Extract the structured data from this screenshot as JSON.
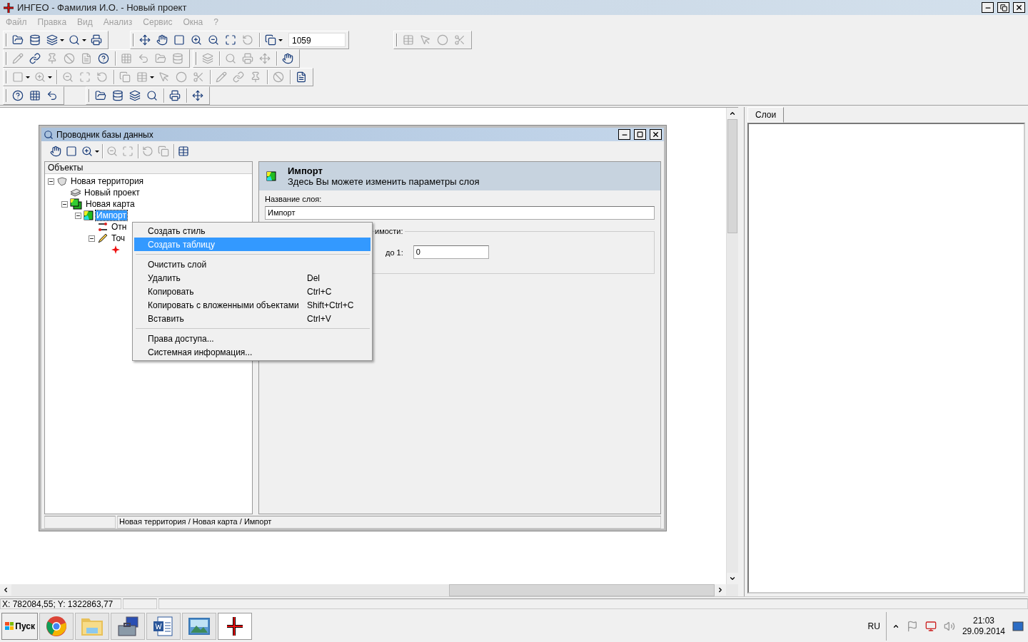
{
  "window": {
    "title": "ИНГЕО - Фамилия И.О. - Новый проект"
  },
  "menu": [
    {
      "label": "Файл",
      "disabled": true
    },
    {
      "label": "Правка",
      "disabled": true
    },
    {
      "label": "Вид",
      "disabled": true
    },
    {
      "label": "Анализ",
      "disabled": true
    },
    {
      "label": "Сервис",
      "disabled": true
    },
    {
      "label": "Окна",
      "disabled": true
    },
    {
      "label": "?",
      "disabled": true
    }
  ],
  "toolbars": [
    {
      "bars": [
        {
          "groups": [
            {
              "buttons": [
                {
                  "kind": "button",
                  "disabled": false
                },
                {
                  "kind": "button",
                  "disabled": false
                },
                {
                  "kind": "dropdown",
                  "disabled": false
                },
                {
                  "kind": "dropdown",
                  "disabled": false
                },
                {
                  "kind": "button",
                  "disabled": false
                }
              ]
            }
          ]
        },
        {
          "groups": [
            {
              "buttons": [
                {
                  "kind": "button",
                  "disabled": false
                },
                {
                  "kind": "button",
                  "disabled": false
                },
                {
                  "kind": "button",
                  "disabled": false
                },
                {
                  "kind": "button",
                  "disabled": false
                },
                {
                  "kind": "button",
                  "disabled": false
                },
                {
                  "kind": "button",
                  "disabled": false
                },
                {
                  "kind": "button",
                  "disabled": true
                }
              ]
            },
            {
              "buttons": [
                {
                  "kind": "dropdown",
                  "disabled": false
                }
              ]
            }
          ],
          "field": "1059"
        },
        {
          "groups": [
            {
              "buttons": [
                {
                  "kind": "button",
                  "disabled": true
                },
                {
                  "kind": "button",
                  "disabled": true
                },
                {
                  "kind": "button",
                  "disabled": true
                },
                {
                  "kind": "button",
                  "disabled": true
                }
              ]
            }
          ]
        }
      ]
    },
    {
      "bars": [
        {
          "groups": [
            {
              "buttons": [
                {
                  "kind": "button",
                  "disabled": true
                },
                {
                  "kind": "button",
                  "disabled": false
                },
                {
                  "kind": "button",
                  "disabled": true
                },
                {
                  "kind": "button",
                  "disabled": true
                },
                {
                  "kind": "button",
                  "disabled": true
                },
                {
                  "kind": "button",
                  "disabled": false
                }
              ]
            },
            {
              "buttons": [
                {
                  "kind": "button",
                  "disabled": true
                },
                {
                  "kind": "button",
                  "disabled": true
                },
                {
                  "kind": "button",
                  "disabled": true
                },
                {
                  "kind": "button",
                  "disabled": true
                }
              ]
            }
          ]
        },
        {
          "groups": [
            {
              "buttons": [
                {
                  "kind": "button",
                  "disabled": true
                }
              ]
            },
            {
              "buttons": [
                {
                  "kind": "button",
                  "disabled": true
                },
                {
                  "kind": "button",
                  "disabled": true
                },
                {
                  "kind": "button",
                  "disabled": true
                }
              ]
            },
            {
              "buttons": [
                {
                  "kind": "button",
                  "disabled": false
                }
              ]
            }
          ]
        }
      ]
    },
    {
      "bars": [
        {
          "groups": [
            {
              "buttons": [
                {
                  "kind": "dropdown",
                  "disabled": true
                },
                {
                  "kind": "dropdown",
                  "disabled": true
                }
              ]
            },
            {
              "buttons": [
                {
                  "kind": "button",
                  "disabled": true
                },
                {
                  "kind": "button",
                  "disabled": true
                },
                {
                  "kind": "button",
                  "disabled": true
                }
              ]
            },
            {
              "buttons": [
                {
                  "kind": "button",
                  "disabled": true
                },
                {
                  "kind": "dropdown",
                  "disabled": true
                },
                {
                  "kind": "button",
                  "disabled": true
                },
                {
                  "kind": "button",
                  "disabled": true
                },
                {
                  "kind": "button",
                  "disabled": true
                }
              ]
            },
            {
              "buttons": [
                {
                  "kind": "button",
                  "disabled": true
                },
                {
                  "kind": "button",
                  "disabled": true
                },
                {
                  "kind": "button",
                  "disabled": true
                }
              ]
            },
            {
              "buttons": [
                {
                  "kind": "button",
                  "disabled": true
                }
              ]
            },
            {
              "buttons": [
                {
                  "kind": "button",
                  "disabled": false
                }
              ]
            }
          ]
        }
      ]
    },
    {
      "bars": [
        {
          "groups": [
            {
              "buttons": [
                {
                  "kind": "button",
                  "disabled": false
                },
                {
                  "kind": "button",
                  "disabled": false
                },
                {
                  "kind": "button",
                  "disabled": false
                }
              ]
            }
          ]
        },
        {
          "groups": [
            {
              "buttons": [
                {
                  "kind": "button",
                  "disabled": false
                },
                {
                  "kind": "button",
                  "disabled": false
                },
                {
                  "kind": "button",
                  "disabled": false
                },
                {
                  "kind": "button",
                  "disabled": false
                }
              ]
            },
            {
              "buttons": [
                {
                  "kind": "button",
                  "disabled": false
                }
              ]
            },
            {
              "buttons": [
                {
                  "kind": "button",
                  "disabled": false
                }
              ]
            }
          ]
        }
      ]
    }
  ],
  "explorer": {
    "title": "Проводник базы данных",
    "toolbar": [
      {
        "buttons": [
          {
            "kind": "button",
            "disabled": false
          },
          {
            "kind": "button",
            "disabled": false
          },
          {
            "kind": "dropdown",
            "disabled": false
          }
        ]
      },
      {
        "buttons": [
          {
            "kind": "button",
            "disabled": true
          },
          {
            "kind": "button",
            "disabled": true
          }
        ]
      },
      {
        "buttons": [
          {
            "kind": "button",
            "disabled": true
          },
          {
            "kind": "button",
            "disabled": true
          }
        ]
      },
      {
        "buttons": [
          {
            "kind": "button",
            "disabled": false
          }
        ]
      }
    ],
    "tree": {
      "header": "Объекты",
      "items": [
        {
          "kind": "territory",
          "label": "Новая территория",
          "selected": false,
          "expanded": true,
          "children": [
            {
              "kind": "project",
              "label": "Новый проект",
              "selected": false
            },
            {
              "kind": "map",
              "label": "Новая карта",
              "selected": false,
              "expanded": true,
              "children": [
                {
                  "kind": "layer",
                  "label": "Импорт",
                  "selected": true,
                  "expanded": true,
                  "children": [
                    {
                      "kind": "relation",
                      "label": "Отн",
                      "selected": false
                    },
                    {
                      "kind": "points",
                      "label": "Точ",
                      "selected": false,
                      "expanded": true,
                      "children": [
                        {
                          "kind": "point"
                        }
                      ]
                    }
                  ]
                }
              ]
            }
          ]
        }
      ]
    },
    "details": {
      "title": "Импорт",
      "subtitle": "Здесь Вы можете изменить параметры слоя",
      "name_label": "Название слоя:",
      "name_value": "Импорт",
      "group_label": "имости:",
      "to_label": "до 1:",
      "to_value": "0"
    },
    "status": "Новая территория / Новая карта / Импорт"
  },
  "context_menu": [
    {
      "kind": "item",
      "label": "Создать стиль",
      "selected": false
    },
    {
      "kind": "item",
      "label": "Создать таблицу",
      "selected": true
    },
    {
      "kind": "separator"
    },
    {
      "kind": "item",
      "label": "Очистить слой",
      "selected": false
    },
    {
      "kind": "item",
      "label": "Удалить",
      "shortcut": "Del",
      "selected": false
    },
    {
      "kind": "item",
      "label": "Копировать",
      "shortcut": "Ctrl+C",
      "selected": false
    },
    {
      "kind": "item",
      "label": "Копировать с вложенными объектами",
      "shortcut": "Shift+Ctrl+C",
      "selected": false
    },
    {
      "kind": "item",
      "label": "Вставить",
      "shortcut": "Ctrl+V",
      "selected": false
    },
    {
      "kind": "separator"
    },
    {
      "kind": "item",
      "label": "Права доступа...",
      "selected": false
    },
    {
      "kind": "item",
      "label": "Системная информация...",
      "selected": false
    }
  ],
  "layers_panel": {
    "tab": "Слои"
  },
  "status_bar": {
    "coords": "X: 782084,55; Y: 1322863,77"
  },
  "taskbar": {
    "start": "Пуск",
    "apps": [
      {
        "selected": false
      },
      {
        "selected": false
      },
      {
        "selected": false
      },
      {
        "selected": false
      },
      {
        "selected": false
      },
      {
        "selected": true
      }
    ],
    "lang": "RU",
    "time": "21:03",
    "date": "29.09.2014"
  }
}
